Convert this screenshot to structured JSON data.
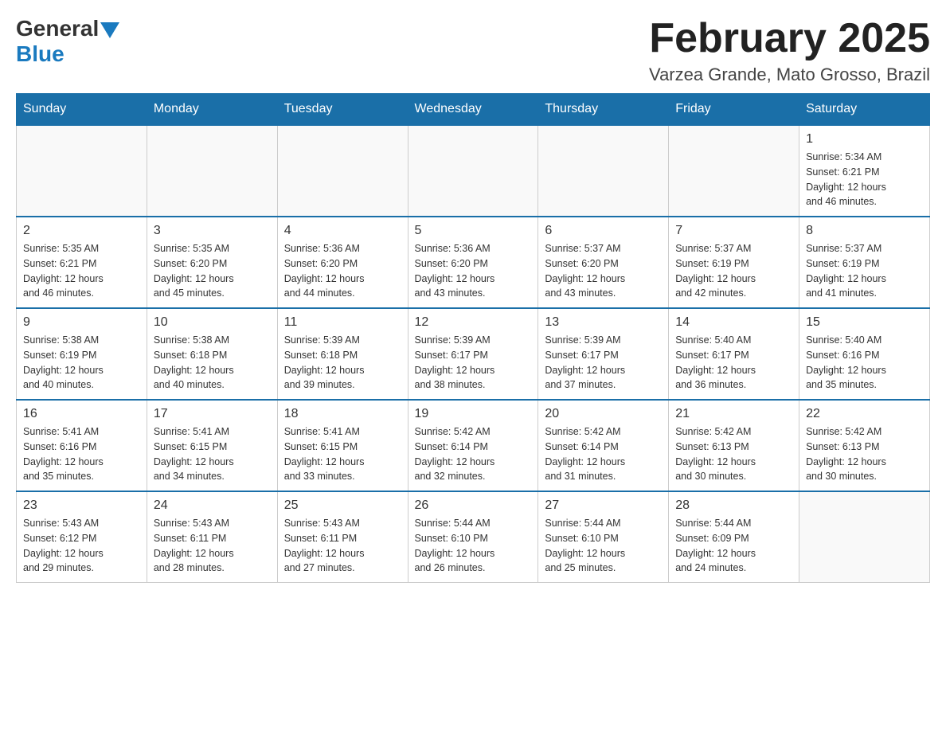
{
  "header": {
    "logo_general": "General",
    "logo_blue": "Blue",
    "main_title": "February 2025",
    "subtitle": "Varzea Grande, Mato Grosso, Brazil"
  },
  "days_of_week": [
    "Sunday",
    "Monday",
    "Tuesday",
    "Wednesday",
    "Thursday",
    "Friday",
    "Saturday"
  ],
  "weeks": [
    [
      {
        "day": "",
        "info": ""
      },
      {
        "day": "",
        "info": ""
      },
      {
        "day": "",
        "info": ""
      },
      {
        "day": "",
        "info": ""
      },
      {
        "day": "",
        "info": ""
      },
      {
        "day": "",
        "info": ""
      },
      {
        "day": "1",
        "info": "Sunrise: 5:34 AM\nSunset: 6:21 PM\nDaylight: 12 hours\nand 46 minutes."
      }
    ],
    [
      {
        "day": "2",
        "info": "Sunrise: 5:35 AM\nSunset: 6:21 PM\nDaylight: 12 hours\nand 46 minutes."
      },
      {
        "day": "3",
        "info": "Sunrise: 5:35 AM\nSunset: 6:20 PM\nDaylight: 12 hours\nand 45 minutes."
      },
      {
        "day": "4",
        "info": "Sunrise: 5:36 AM\nSunset: 6:20 PM\nDaylight: 12 hours\nand 44 minutes."
      },
      {
        "day": "5",
        "info": "Sunrise: 5:36 AM\nSunset: 6:20 PM\nDaylight: 12 hours\nand 43 minutes."
      },
      {
        "day": "6",
        "info": "Sunrise: 5:37 AM\nSunset: 6:20 PM\nDaylight: 12 hours\nand 43 minutes."
      },
      {
        "day": "7",
        "info": "Sunrise: 5:37 AM\nSunset: 6:19 PM\nDaylight: 12 hours\nand 42 minutes."
      },
      {
        "day": "8",
        "info": "Sunrise: 5:37 AM\nSunset: 6:19 PM\nDaylight: 12 hours\nand 41 minutes."
      }
    ],
    [
      {
        "day": "9",
        "info": "Sunrise: 5:38 AM\nSunset: 6:19 PM\nDaylight: 12 hours\nand 40 minutes."
      },
      {
        "day": "10",
        "info": "Sunrise: 5:38 AM\nSunset: 6:18 PM\nDaylight: 12 hours\nand 40 minutes."
      },
      {
        "day": "11",
        "info": "Sunrise: 5:39 AM\nSunset: 6:18 PM\nDaylight: 12 hours\nand 39 minutes."
      },
      {
        "day": "12",
        "info": "Sunrise: 5:39 AM\nSunset: 6:17 PM\nDaylight: 12 hours\nand 38 minutes."
      },
      {
        "day": "13",
        "info": "Sunrise: 5:39 AM\nSunset: 6:17 PM\nDaylight: 12 hours\nand 37 minutes."
      },
      {
        "day": "14",
        "info": "Sunrise: 5:40 AM\nSunset: 6:17 PM\nDaylight: 12 hours\nand 36 minutes."
      },
      {
        "day": "15",
        "info": "Sunrise: 5:40 AM\nSunset: 6:16 PM\nDaylight: 12 hours\nand 35 minutes."
      }
    ],
    [
      {
        "day": "16",
        "info": "Sunrise: 5:41 AM\nSunset: 6:16 PM\nDaylight: 12 hours\nand 35 minutes."
      },
      {
        "day": "17",
        "info": "Sunrise: 5:41 AM\nSunset: 6:15 PM\nDaylight: 12 hours\nand 34 minutes."
      },
      {
        "day": "18",
        "info": "Sunrise: 5:41 AM\nSunset: 6:15 PM\nDaylight: 12 hours\nand 33 minutes."
      },
      {
        "day": "19",
        "info": "Sunrise: 5:42 AM\nSunset: 6:14 PM\nDaylight: 12 hours\nand 32 minutes."
      },
      {
        "day": "20",
        "info": "Sunrise: 5:42 AM\nSunset: 6:14 PM\nDaylight: 12 hours\nand 31 minutes."
      },
      {
        "day": "21",
        "info": "Sunrise: 5:42 AM\nSunset: 6:13 PM\nDaylight: 12 hours\nand 30 minutes."
      },
      {
        "day": "22",
        "info": "Sunrise: 5:42 AM\nSunset: 6:13 PM\nDaylight: 12 hours\nand 30 minutes."
      }
    ],
    [
      {
        "day": "23",
        "info": "Sunrise: 5:43 AM\nSunset: 6:12 PM\nDaylight: 12 hours\nand 29 minutes."
      },
      {
        "day": "24",
        "info": "Sunrise: 5:43 AM\nSunset: 6:11 PM\nDaylight: 12 hours\nand 28 minutes."
      },
      {
        "day": "25",
        "info": "Sunrise: 5:43 AM\nSunset: 6:11 PM\nDaylight: 12 hours\nand 27 minutes."
      },
      {
        "day": "26",
        "info": "Sunrise: 5:44 AM\nSunset: 6:10 PM\nDaylight: 12 hours\nand 26 minutes."
      },
      {
        "day": "27",
        "info": "Sunrise: 5:44 AM\nSunset: 6:10 PM\nDaylight: 12 hours\nand 25 minutes."
      },
      {
        "day": "28",
        "info": "Sunrise: 5:44 AM\nSunset: 6:09 PM\nDaylight: 12 hours\nand 24 minutes."
      },
      {
        "day": "",
        "info": ""
      }
    ]
  ]
}
